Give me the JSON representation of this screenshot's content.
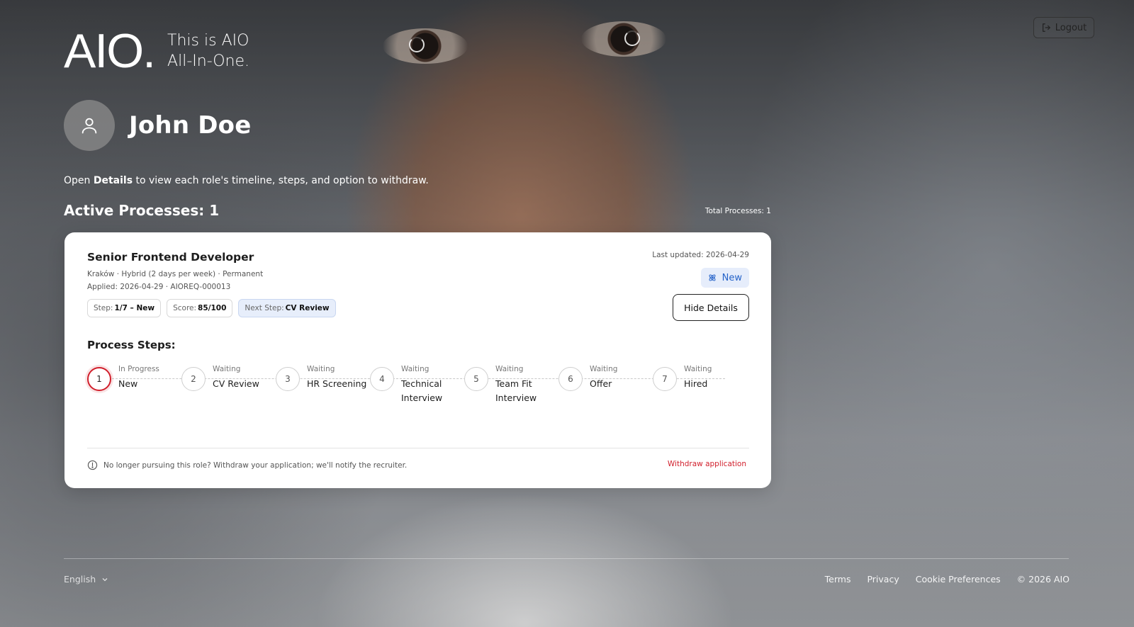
{
  "brand": {
    "logo": "AIO.",
    "tagline_line1": "This is AIO",
    "tagline_line2": "All-In-One."
  },
  "header": {
    "logout_label": "Logout",
    "logout_icon": "logout-icon"
  },
  "profile": {
    "name": "John Doe",
    "avatar_icon": "user-icon"
  },
  "hint": {
    "prefix": "Open ",
    "emphasis": "Details",
    "suffix": " to view each role's timeline, steps, and option to withdraw."
  },
  "processes": {
    "active_label": "Active Processes: 1",
    "total_label": "Total Processes: 1"
  },
  "job": {
    "title": "Senior Frontend Developer",
    "meta": "Kraków · Hybrid (2 days per week) · Permanent",
    "applied": "Applied: 2026-04-29 · AIOREQ-000013",
    "last_updated": "Last updated: 2026-04-29",
    "status": "New",
    "status_icon": "atom-icon",
    "status_color": "#2563c9",
    "hide_details_label": "Hide Details",
    "chips": {
      "step_key": "Step:",
      "step_value": "1/7 – New",
      "score_key": "Score:",
      "score_value": "85/100",
      "next_key": "Next Step:",
      "next_value": "CV Review"
    },
    "steps_title": "Process Steps:",
    "steps": [
      {
        "number": "1",
        "status": "In Progress",
        "label": "New"
      },
      {
        "number": "2",
        "status": "Waiting",
        "label": "CV Review"
      },
      {
        "number": "3",
        "status": "Waiting",
        "label": "HR Screening"
      },
      {
        "number": "4",
        "status": "Waiting",
        "label": "Technical Interview"
      },
      {
        "number": "5",
        "status": "Waiting",
        "label": "Team Fit Interview"
      },
      {
        "number": "6",
        "status": "Waiting",
        "label": "Offer"
      },
      {
        "number": "7",
        "status": "Waiting",
        "label": "Hired"
      }
    ],
    "active_step_color": "#d11f2c",
    "withdraw_note": "No longer pursuing this role? Withdraw your application; we'll notify the recruiter.",
    "withdraw_link": "Withdraw application"
  },
  "footer": {
    "language": "English",
    "links": [
      "Terms",
      "Privacy",
      "Cookie Preferences"
    ],
    "copyright": "© 2026 AIO"
  }
}
